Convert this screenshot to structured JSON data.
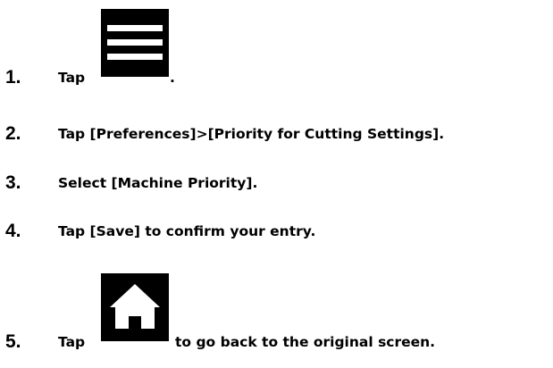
{
  "steps": [
    {
      "number": "1.",
      "text_before": "Tap",
      "text_after": ".",
      "icon": "menu-icon"
    },
    {
      "number": "2.",
      "text": "Tap [Preferences]>[Priority for Cutting Settings]."
    },
    {
      "number": "3.",
      "text": "Select [Machine Priority]."
    },
    {
      "number": "4.",
      "text": "Tap [Save] to confirm your entry."
    },
    {
      "number": "5.",
      "text_before": "Tap",
      "text_after": "to go back to the original screen.",
      "icon": "home-icon"
    }
  ]
}
